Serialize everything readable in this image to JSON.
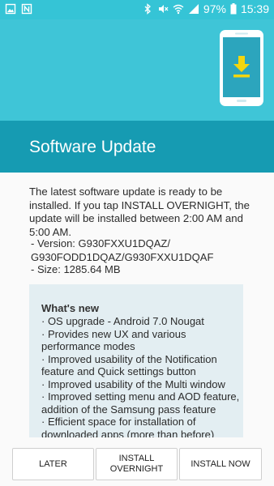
{
  "status_bar": {
    "battery": "97%",
    "time": "15:39",
    "icons": [
      "image-icon",
      "n-icon",
      "bluetooth-icon",
      "mute-icon",
      "wifi-icon",
      "signal-icon",
      "battery-icon"
    ]
  },
  "header": {
    "title": "Software Update",
    "illustration": "phone-download-icon",
    "colors": {
      "top": "#3fc5d7",
      "bottom": "#169bb2",
      "arrow": "#f3d60f"
    }
  },
  "content": {
    "description": "The latest software update is ready to be installed. If you tap INSTALL OVERNIGHT, the update will be installed between 2:00 AM and 5:00 AM.",
    "version_line1": " - Version: G930FXXU1DQAZ/",
    "version_line2": "G930FODD1DQAZ/G930FXXU1DQAF",
    "size": " - Size: 1285.64 MB",
    "whats_new": {
      "title": "What's new",
      "items": [
        "· OS upgrade - Android 7.0 Nougat",
        "· Provides new UX and various performance modes",
        "· Improved usability of the Notification feature and Quick settings button",
        "· Improved usability of the Multi window",
        "· Improved setting menu and AOD feature, addition of the Samsung pass feature",
        "· Efficient space for installation of downloaded apps (more than before)"
      ]
    }
  },
  "buttons": {
    "later": "LATER",
    "install_overnight_1": "INSTALL",
    "install_overnight_2": "OVERNIGHT",
    "install_now": "INSTALL NOW"
  }
}
